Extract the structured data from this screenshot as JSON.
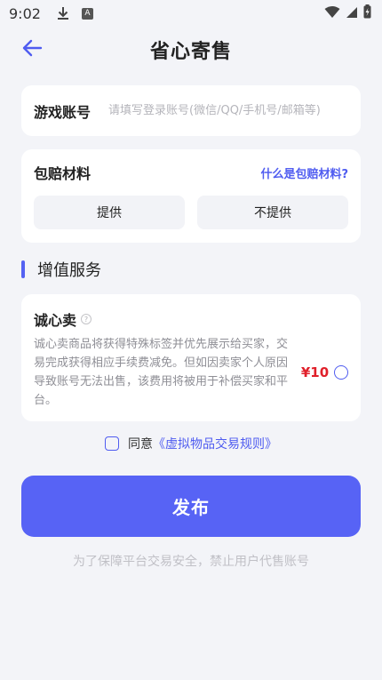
{
  "status_bar": {
    "time": "9:02",
    "icons": [
      "download-icon",
      "a-icon",
      "wifi-icon",
      "signal-icon",
      "battery-charging-icon"
    ],
    "a_icon_glyph": "A"
  },
  "header": {
    "title": "省心寄售",
    "back_icon": "arrow-left-icon",
    "accent_color": "#4f5cf0"
  },
  "account": {
    "label": "游戏账号",
    "placeholder": "请填写登录账号(微信/QQ/手机号/邮箱等)",
    "value": ""
  },
  "compensation": {
    "label": "包赔材料",
    "help_link": "什么是包赔材料?",
    "options": [
      "提供",
      "不提供"
    ]
  },
  "value_added": {
    "section_title": "增值服务",
    "service": {
      "name": "诚心卖",
      "help_glyph": "?",
      "description": "诚心卖商品将获得特殊标签并优先展示给买家，交易完成获得相应手续费减免。但如因卖家个人原因导致账号无法出售，该费用将被用于补偿买家和平台。",
      "price": "¥10",
      "selected": false
    }
  },
  "agreement": {
    "prefix": "同意",
    "link": "《虚拟物品交易规则》",
    "checked": false
  },
  "publish_button": "发布",
  "footer_note": "为了保障平台交易安全，禁止用户代售账号",
  "colors": {
    "primary": "#5763f5",
    "price": "#e0202a",
    "background": "#f3f4f8"
  }
}
